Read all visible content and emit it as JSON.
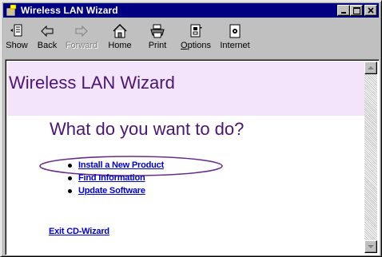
{
  "window": {
    "title": "Wireless LAN Wizard",
    "icon": "wizard-question-icon"
  },
  "title_buttons": {
    "minimize": "▁",
    "maximize": "□",
    "close": "✕"
  },
  "toolbar": {
    "show": "Show",
    "back": "Back",
    "forward": "Forward",
    "home": "Home",
    "print": "Print",
    "options": "Options",
    "internet": "Internet"
  },
  "page": {
    "heading": "Wireless LAN Wizard",
    "question": "What do you want to do?",
    "links": [
      "Install a New Product",
      "Find Information",
      "Update Software"
    ],
    "exit": "Exit CD-Wizard"
  },
  "colors": {
    "title_bar": "#000080",
    "header_band": "#f3e3fb",
    "heading_text": "#4a1673",
    "link": "#0000cc",
    "highlight_ellipse": "#6a2d86"
  }
}
